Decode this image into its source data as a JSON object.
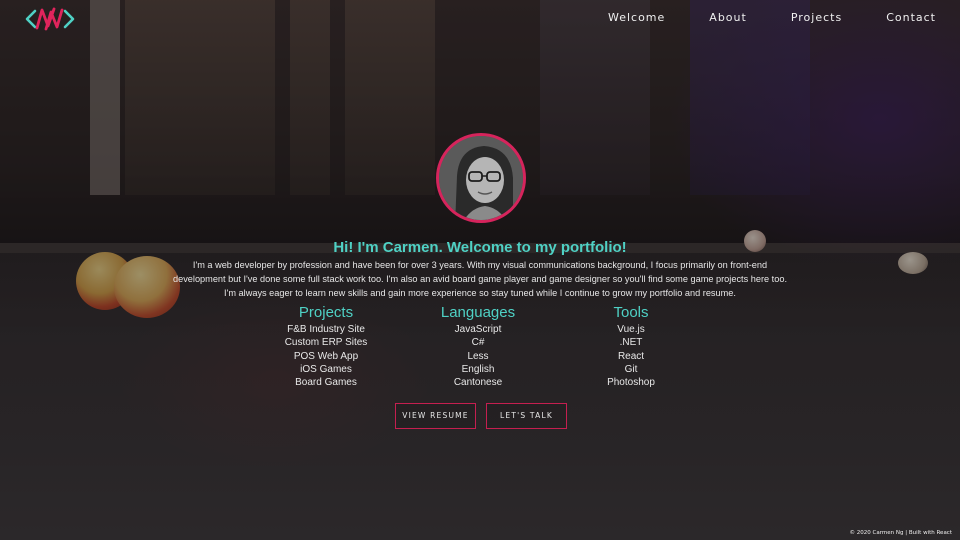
{
  "header": {
    "logo_icon": "nn-logo-icon",
    "nav": [
      {
        "label": "Welcome"
      },
      {
        "label": "About"
      },
      {
        "label": "Projects"
      },
      {
        "label": "Contact"
      }
    ]
  },
  "hero": {
    "avatar_icon": "profile-photo",
    "greeting": "Hi! I'm Carmen. Welcome to my portfolio!",
    "intro": "I'm a web developer by profession and have been for over 3 years. With my visual communications background, I focus primarily on front-end development but I've done some full stack work too. I'm also an avid board game player and game designer so you'll find some game projects here too. I'm always eager to learn new skills and gain more experience so stay tuned while I continue to grow my portfolio and resume."
  },
  "columns": [
    {
      "title": "Projects",
      "items": [
        "F&B Industry Site",
        "Custom ERP Sites",
        "POS Web App",
        "iOS Games",
        "Board Games"
      ]
    },
    {
      "title": "Languages",
      "items": [
        "JavaScript",
        "C#",
        "Less",
        "English",
        "Cantonese"
      ]
    },
    {
      "title": "Tools",
      "items": [
        "Vue.js",
        ".NET",
        "React",
        "Git",
        "Photoshop"
      ]
    }
  ],
  "buttons": {
    "resume": "VIEW RESUME",
    "talk": "LET'S TALK"
  },
  "footer": "© 2020 Carmen Ng | Built with React",
  "colors": {
    "accent_teal": "#4fd1c5",
    "accent_pink": "#d6245c"
  }
}
